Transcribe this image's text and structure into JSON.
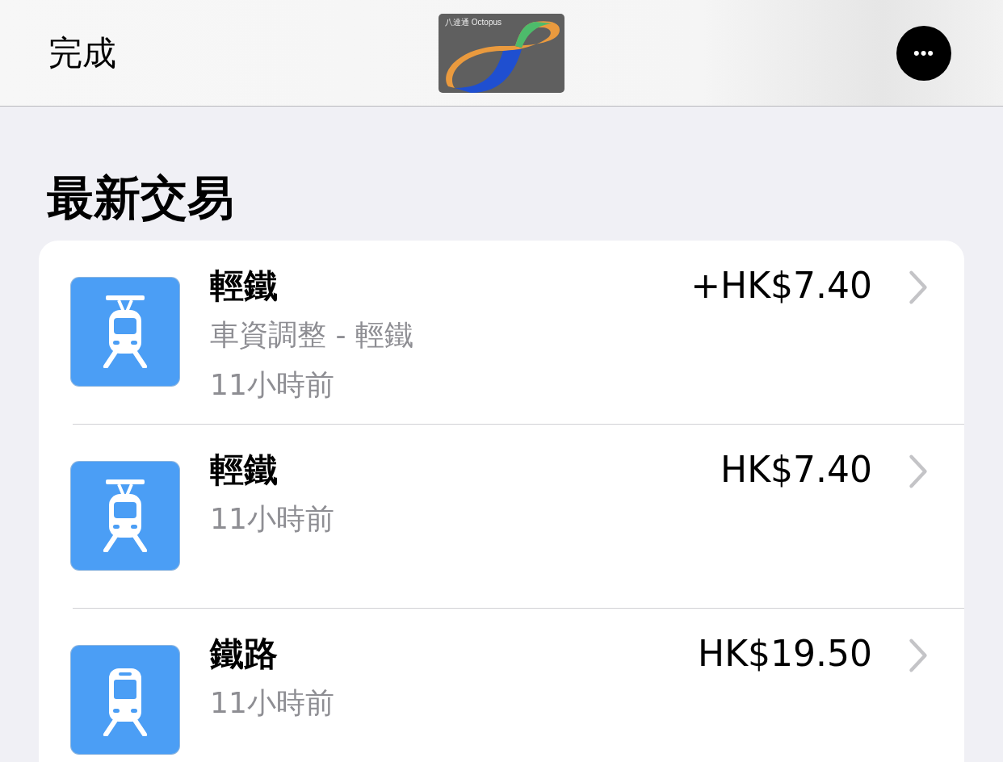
{
  "header": {
    "done": "完成",
    "card_label": "八達通 Octopus",
    "more": "•••"
  },
  "section_title": "最新交易",
  "transactions": [
    {
      "kind": "tram",
      "title": "輕鐵",
      "amount": "+HK$7.40",
      "details": [
        "車資調整 - 輕鐵",
        "11小時前"
      ]
    },
    {
      "kind": "tram",
      "title": "輕鐵",
      "amount": "HK$7.40",
      "details": [
        "11小時前"
      ]
    },
    {
      "kind": "train",
      "title": "鐵路",
      "amount": "HK$19.50",
      "details": [
        "11小時前"
      ]
    }
  ]
}
